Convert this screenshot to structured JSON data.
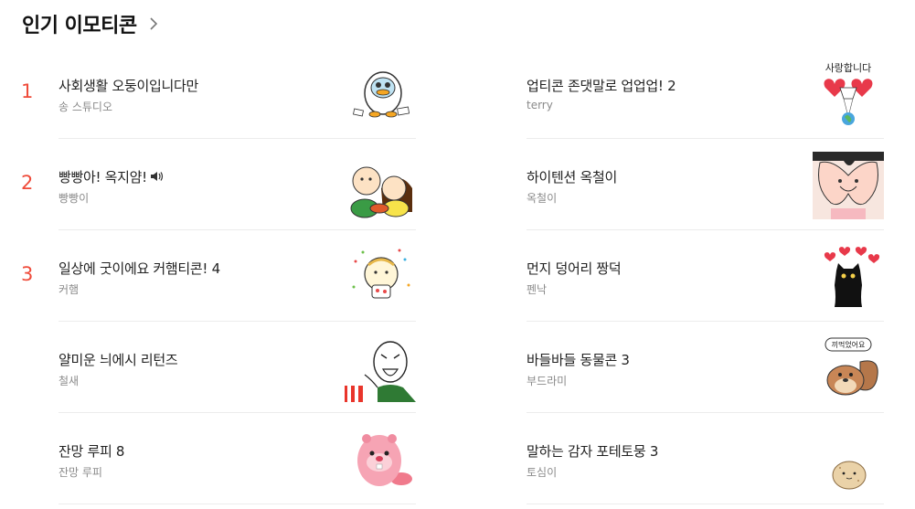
{
  "header": {
    "title": "인기 이모티콘",
    "arrow_icon": "chevron-right-icon"
  },
  "colors": {
    "rank": "#ef4b3a",
    "title": "#222222",
    "author": "#8a8a8a",
    "divider": "#ececec"
  },
  "left_items": [
    {
      "rank": "1",
      "title": "사회생활 오둥이입니다만",
      "author": "송 스튜디오",
      "sticker": "penguin-sticker"
    },
    {
      "rank": "2",
      "title": "빵빵아! 옥지얌!",
      "author": "빵빵이",
      "sticker": "couple-eating-sticker",
      "sound_icon": "speaker-icon"
    },
    {
      "rank": "3",
      "title": "일상에 굿이에요 커햄티콘! 4",
      "author": "커햄",
      "sticker": "hamster-cake-sticker"
    },
    {
      "rank": "",
      "title": "얄미운 늬에시 리턴즈",
      "author": "철새",
      "sticker": "laughing-man-sticker"
    },
    {
      "rank": "",
      "title": "잔망 루피 8",
      "author": "잔망 루피",
      "sticker": "pink-beaver-sticker"
    }
  ],
  "right_items": [
    {
      "title": "업티콘 존댓말로 업업업! 2",
      "author": "terry",
      "sticker": "hearts-parachute-sticker",
      "sticker_text": "사랑합니다"
    },
    {
      "title": "하이텐션 옥철이",
      "author": "옥철이",
      "sticker": "heart-hands-face-sticker"
    },
    {
      "title": "먼지 덩어리 짱덕",
      "author": "펜낙",
      "sticker": "black-cat-hearts-sticker"
    },
    {
      "title": "바들바들 동물콘 3",
      "author": "부드라미",
      "sticker": "squirrel-sticker",
      "sticker_text": "끼먹었어요"
    },
    {
      "title": "말하는 감자 포테토뭉 3",
      "author": "토심이",
      "sticker": "potato-sticker"
    }
  ]
}
